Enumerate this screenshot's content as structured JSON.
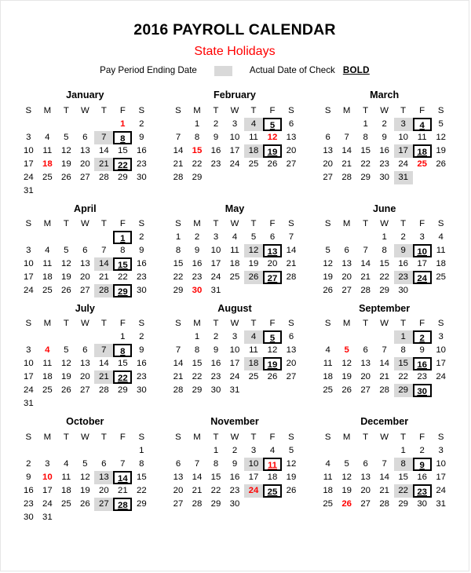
{
  "header": {
    "title": "2016 PAYROLL CALENDAR",
    "subtitle": "State Holidays",
    "legend": {
      "pay_period_label": "Pay Period Ending Date",
      "swatch_color": "#d9d9d9",
      "check_label": "Actual Date of Check",
      "check_marker": "BOLD"
    }
  },
  "colors": {
    "holiday_red": "#ff0000",
    "shade_grey": "#d9d9d9",
    "text_black": "#000000"
  },
  "weekday_headers": [
    "S",
    "M",
    "T",
    "W",
    "T",
    "F",
    "S"
  ],
  "months": [
    {
      "name": "January",
      "lead_blanks": 5,
      "days": 31,
      "shade": [
        7,
        21
      ],
      "holiday": [
        1,
        18
      ],
      "check": [
        8,
        22
      ]
    },
    {
      "name": "February",
      "lead_blanks": 1,
      "days": 29,
      "shade": [
        4,
        18
      ],
      "holiday": [
        12,
        15
      ],
      "check": [
        5,
        19
      ]
    },
    {
      "name": "March",
      "lead_blanks": 2,
      "days": 31,
      "shade": [
        3,
        17,
        31
      ],
      "holiday": [
        25
      ],
      "check": [
        4,
        18
      ]
    },
    {
      "name": "April",
      "lead_blanks": 5,
      "days": 30,
      "shade": [
        14,
        28
      ],
      "holiday": [],
      "check": [
        1,
        15,
        29
      ]
    },
    {
      "name": "May",
      "lead_blanks": 0,
      "days": 31,
      "shade": [
        12,
        26
      ],
      "holiday": [
        30
      ],
      "check": [
        13,
        27
      ]
    },
    {
      "name": "June",
      "lead_blanks": 3,
      "days": 30,
      "shade": [
        9,
        23
      ],
      "holiday": [],
      "check": [
        10,
        24
      ]
    },
    {
      "name": "July",
      "lead_blanks": 5,
      "days": 31,
      "shade": [
        7,
        21
      ],
      "holiday": [
        4
      ],
      "check": [
        8,
        22
      ]
    },
    {
      "name": "August",
      "lead_blanks": 1,
      "days": 31,
      "shade": [
        4,
        18
      ],
      "holiday": [],
      "check": [
        5,
        19
      ]
    },
    {
      "name": "September",
      "lead_blanks": 4,
      "days": 30,
      "shade": [
        1,
        15,
        29
      ],
      "holiday": [
        5
      ],
      "check": [
        2,
        16,
        30
      ]
    },
    {
      "name": "October",
      "lead_blanks": 6,
      "days": 31,
      "shade": [
        13,
        27
      ],
      "holiday": [
        10
      ],
      "check": [
        14,
        28
      ]
    },
    {
      "name": "November",
      "lead_blanks": 2,
      "days": 30,
      "shade": [
        10,
        24
      ],
      "holiday": [
        11,
        24
      ],
      "check": [
        11,
        25
      ]
    },
    {
      "name": "December",
      "lead_blanks": 4,
      "days": 31,
      "shade": [
        8,
        22
      ],
      "holiday": [
        26
      ],
      "check": [
        9,
        23
      ]
    }
  ]
}
